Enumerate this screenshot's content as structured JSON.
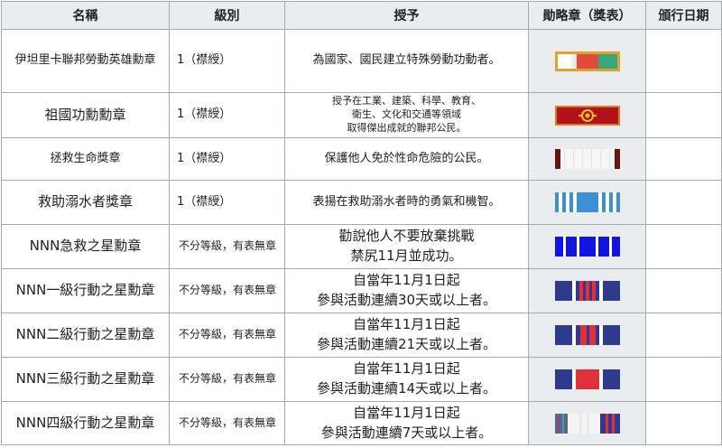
{
  "headers": [
    "名稱",
    "級別",
    "授予",
    "勛略章（獎表）",
    "頒行日期"
  ],
  "rows": [
    {
      "name": "伊坦里卡聯邦勞動英雄勳章",
      "level": "1（襟綬）",
      "desc": [
        "為國家、國民建立特殊勞動功動者。"
      ],
      "ribbon": "ribbon-labor-hero"
    },
    {
      "name": "祖國功勳勳章",
      "level": "1（襟綬）",
      "desc": [
        "授予在工業、建築、科學、教育、",
        "衛生、文化和交通等領域",
        "取得傑出成就的聯邦公民。"
      ],
      "ribbon": "ribbon-merit"
    },
    {
      "name": "拯救生命獎章",
      "level": "1（襟綬）",
      "desc": [
        "保護他人免於性命危險的公民。"
      ],
      "ribbon": "ribbon-lifesaving"
    },
    {
      "name": "救助溺水者獎章",
      "level": "1（襟綬）",
      "desc": [
        "表揚在救助溺水者時的勇氣和機智。"
      ],
      "ribbon": "ribbon-drowning"
    },
    {
      "name": "NNN急救之星勳章",
      "level": "不分等級，有表無章",
      "desc": [
        "勸說他人不要放棄挑戰",
        "禁尻11月並成功。"
      ],
      "ribbon": "ribbon-firstaid"
    },
    {
      "name": "NNN一級行動之星勳章",
      "level": "不分等級，有表無章",
      "desc": [
        "自當年11月1日起",
        "參與活動連續30天或以上者。"
      ],
      "ribbon": "ribbon-action-1"
    },
    {
      "name": "NNN二級行動之星勳章",
      "level": "不分等級，有表無章",
      "desc": [
        "自當年11月1日起",
        "參與活動連續21天或以上者。"
      ],
      "ribbon": "ribbon-action-2"
    },
    {
      "name": "NNN三級行動之星勳章",
      "level": "不分等級，有表無章",
      "desc": [
        "自當年11月1日起",
        "參與活動連續14天或以上者。"
      ],
      "ribbon": "ribbon-action-3"
    },
    {
      "name": "NNN四級行動之星勳章",
      "level": "不分等級，有表無章",
      "desc": [
        "自當年11月1日起",
        "參與活動連續7天或以上者。"
      ],
      "ribbon": "ribbon-action-4"
    }
  ],
  "colors": {
    "gold": "#d9a62a",
    "red": "#e04b3c",
    "green": "#3aa77a",
    "crimson": "#b3121a",
    "maroon": "#6a1410",
    "sky": "#3a8fd6",
    "blue": "#1414e0",
    "navy": "#2e3b8c",
    "scarlet": "#e0303a"
  }
}
